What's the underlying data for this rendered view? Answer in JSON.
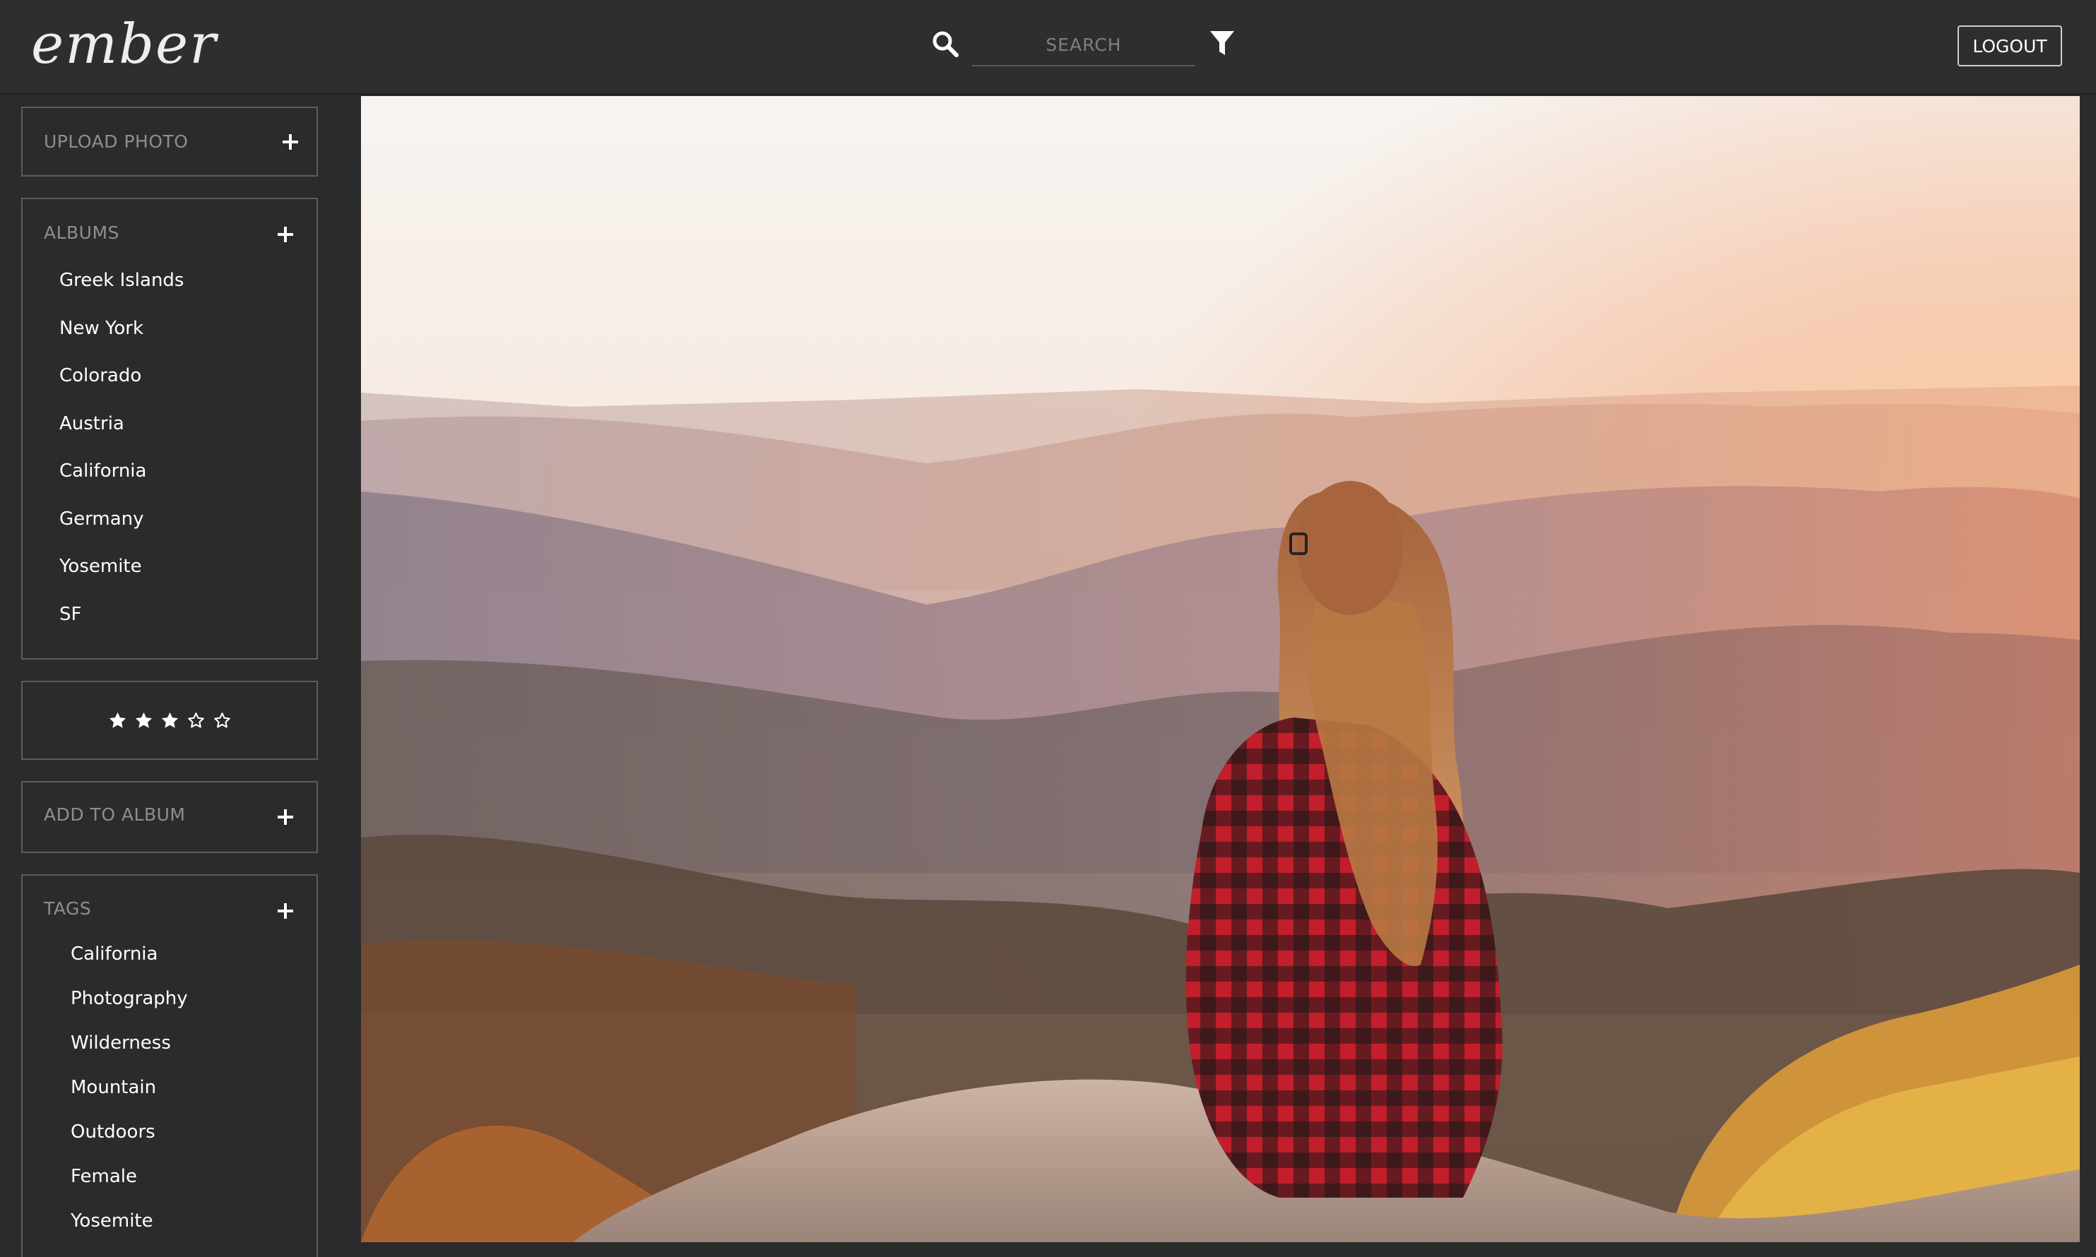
{
  "app": {
    "logo_text": "ember"
  },
  "header": {
    "search_placeholder": "SEARCH",
    "search_icon": "search-icon",
    "filter_icon": "filter-icon",
    "logout_label": "LOGOUT"
  },
  "sidebar": {
    "upload": {
      "label": "UPLOAD PHOTO",
      "icon": "plus-icon"
    },
    "albums": {
      "label": "ALBUMS",
      "icon": "plus-icon",
      "items": [
        "Greek Islands",
        "New York",
        "Colorado",
        "Austria",
        "California",
        "Germany",
        "Yosemite",
        "SF"
      ]
    },
    "rating": {
      "value": 3,
      "max": 5,
      "filled_icon": "star-filled-icon",
      "empty_icon": "star-outline-icon"
    },
    "add_to_album": {
      "label": "ADD TO ALBUM",
      "icon": "plus-icon"
    },
    "tags": {
      "label": "TAGS",
      "icon": "plus-icon",
      "items": [
        "California",
        "Photography",
        "Wilderness",
        "Mountain",
        "Outdoors",
        "Female",
        "Yosemite"
      ]
    }
  },
  "main": {
    "photo_subject": "woman in red plaid shirt sitting on a rock overlooking mountains at sunset"
  },
  "colors": {
    "background": "#2b2b2b",
    "topbar": "#2e2e2e",
    "panel_border": "#5c5c5c",
    "muted_text": "#8e8e8e",
    "text": "#ffffff"
  }
}
